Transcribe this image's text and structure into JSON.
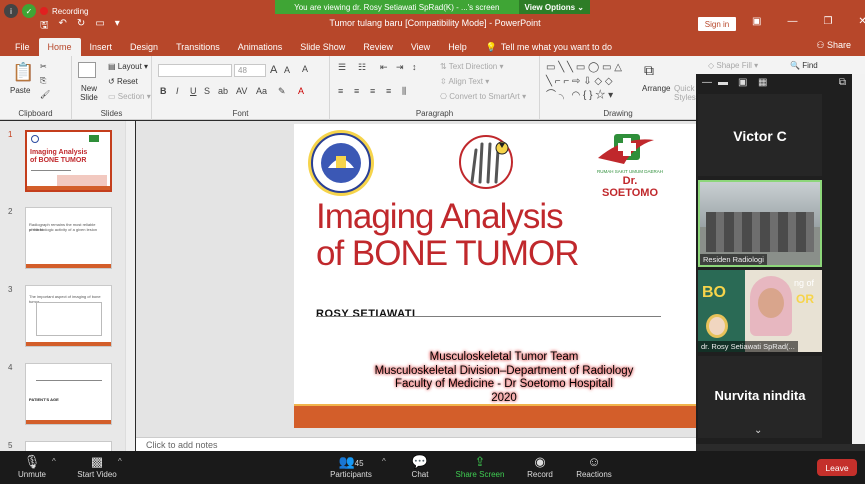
{
  "recording": {
    "label": "Recording"
  },
  "banner": {
    "message": "You are viewing dr. Rosy Setiawati SpRad(K) - ...'s screen",
    "view_options": "View Options"
  },
  "app": {
    "doc_title": "Tumor tulang baru [Compatibility Mode] - PowerPoint",
    "sign_in": "Sign in",
    "share": "Share"
  },
  "tabs": [
    "File",
    "Home",
    "Insert",
    "Design",
    "Transitions",
    "Animations",
    "Slide Show",
    "Review",
    "View",
    "Help"
  ],
  "tell_me": "Tell me what you want to do",
  "ribbon": {
    "clipboard": {
      "paste": "Paste",
      "label": "Clipboard"
    },
    "slides": {
      "new_slide": "New Slide",
      "layout": "Layout",
      "reset": "Reset",
      "section": "Section",
      "label": "Slides"
    },
    "font": {
      "font_size": "48",
      "label": "Font",
      "grow": "A",
      "shrink": "A",
      "clear": "A"
    },
    "paragraph": {
      "text_direction": "Text Direction",
      "align_text": "Align Text",
      "convert_smartart": "Convert to SmartArt",
      "label": "Paragraph"
    },
    "drawing": {
      "arrange": "Arrange",
      "quick_styles": "Quick Styles",
      "shape_fill": "Shape Fill",
      "label": "Drawing"
    },
    "editing": {
      "find": "Find"
    }
  },
  "thumbnails": [
    {
      "num": "1",
      "lines": [
        "Imaging Analysis",
        "of BONE TUMOR"
      ]
    },
    {
      "num": "2",
      "lines": [
        "Radiograph remains the most reliable predictor",
        "of the biologic activity of a given lesion"
      ]
    },
    {
      "num": "3",
      "lines": [
        "The important aspect of imaging of bone tumor"
      ]
    },
    {
      "num": "4",
      "lines": [
        "PATIENT'S AGE"
      ]
    },
    {
      "num": "5",
      "lines": []
    }
  ],
  "slide": {
    "logo_right_text": "RUMAH SAKIT UMUM DAERAH",
    "logo_right_name": "Dr. SOETOMO",
    "title_line1": "Imaging Analysis",
    "title_line2": "of BONE TUMOR",
    "author": "ROSY SETIAWATI",
    "info_line1": "Musculoskeletal Tumor Team",
    "info_line2": "Musculoskeletal  Division–Department of  Radiology",
    "info_line3": "Faculty of  Medicine  - Dr Soetomo Hospitall",
    "info_line4": "2020"
  },
  "notes": {
    "placeholder": "Click to add notes"
  },
  "gallery": {
    "participant_top": "Victor C",
    "tile2_name": "Residen Radiologi",
    "tile3_name": "dr. Rosy Setiawati SpRad(...",
    "tile3_bg_text1": "BO",
    "tile3_bg_text2": "OR",
    "tile3_bg_text3": "ng of",
    "participant_bottom": "Nurvita nindita"
  },
  "zoom": {
    "unmute": "Unmute",
    "start_video": "Start Video",
    "participants": "Participants",
    "participants_count": "45",
    "chat": "Chat",
    "share_screen": "Share Screen",
    "record": "Record",
    "reactions": "Reactions",
    "leave": "Leave"
  }
}
